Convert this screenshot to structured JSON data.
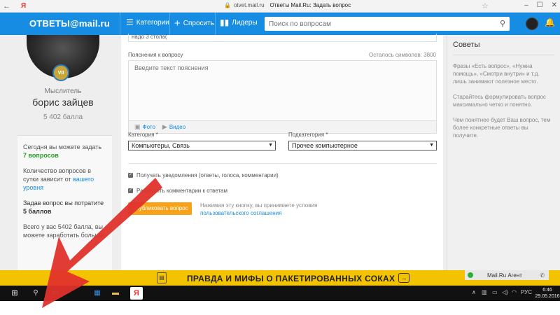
{
  "browser": {
    "y_logo": "Я",
    "url": "otvet.mail.ru",
    "page_title": "Ответы Mail.Ru: Задать вопрос"
  },
  "header": {
    "logo_prefix": "ОТВЕТЫ",
    "logo_at": "@",
    "logo_domain": "mail.ru",
    "nav": {
      "categories": "Категории",
      "ask": "Спросить",
      "leaders": "Лидеры"
    },
    "search_placeholder": "Поиск по вопросам"
  },
  "profile": {
    "badge": "VII",
    "rank": "Мыслитель",
    "name": "борис зайцев",
    "points": "5 402 балла"
  },
  "info": {
    "today_label": "Сегодня вы можете задать",
    "today_value": "7 вопросов",
    "depends_text": "Количество вопросов в сутки зависит от",
    "depends_link": "вашего уровня",
    "cost_label": "Задав вопрос вы потратите",
    "cost_value": "5 баллов",
    "total_text": "Всего у вас 5402 балла, вы можете заработать больше"
  },
  "form": {
    "prev_text": "надо 3 стола(",
    "explain_label": "Пояснения к вопросу",
    "remaining": "Осталось символов: 3800",
    "explain_placeholder": "Введите текст пояснения",
    "photo": "Фото",
    "video": "Видео",
    "category_label": "Категория *",
    "category_value": "Компьютеры, Связь",
    "subcategory_label": "Подкатегория *",
    "subcategory_value": "Прочее компьютерное",
    "notify_label": "Получать уведомления (ответы, голоса, комментарии)",
    "comments_label": "Разрешить комментарии к ответам",
    "publish": "Опубликовать вопрос",
    "terms_text": "Нажимая эту кнопку, вы принимаете условия",
    "terms_link": "пользовательского соглашения"
  },
  "tips": {
    "title": "Советы",
    "p1": "Фразы «Есть вопрос», «Нужна помощь», «Смотри внутри» и т.д. лишь занимают полезное место.",
    "p2": "Старайтесь формулировать вопрос максимально четко и понятно.",
    "p3": "Чем понятнее будет Ваш вопрос, тем более конкретные ответы вы получите."
  },
  "banner": {
    "text": "ПРАВДА И МИФЫ О ПАКЕТИРОВАННЫХ СОКАХ"
  },
  "agent": {
    "label": "Mail.Ru Агент"
  },
  "taskbar": {
    "lang": "РУС",
    "time": "6:46",
    "date": "29.05.2016"
  },
  "colors": {
    "brand_blue": "#168de2",
    "accent_orange": "#f6a31a",
    "banner_yellow": "#f4c300",
    "arrow_red": "#e0322b"
  }
}
